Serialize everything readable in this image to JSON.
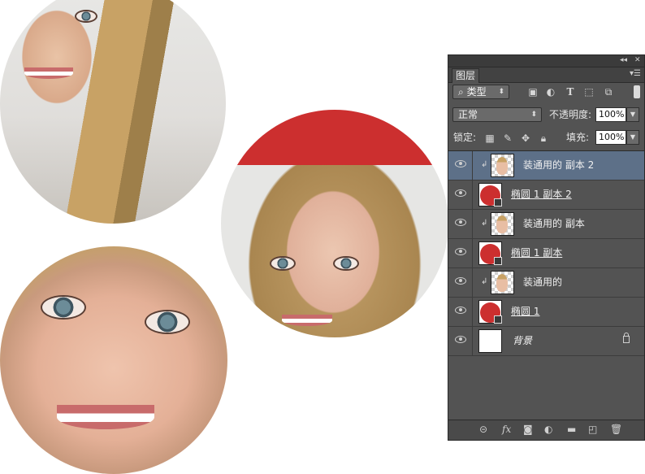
{
  "panel": {
    "collapse_glyph": "◂◂",
    "close_glyph": "✕",
    "tab_label": "图层",
    "menu_glyph": "▾☰",
    "filter": {
      "search_glyph": "⌕",
      "label": "类型",
      "arrow": "⬍"
    },
    "filter_icons": [
      "image-filter-icon",
      "adjustment-filter-icon",
      "type-filter-icon",
      "shape-filter-icon",
      "smart-object-filter-icon"
    ],
    "blend": {
      "value": "正常",
      "arrow": "⬍",
      "opacity_label": "不透明度:",
      "opacity_value": "100%"
    },
    "lock": {
      "label": "锁定:",
      "fill_label": "填充:",
      "fill_value": "100%"
    },
    "layers": [
      {
        "name": "装通用的 副本 2",
        "kind": "photo",
        "clipped": true,
        "selected": true,
        "underline": false,
        "italic": false,
        "locked": false
      },
      {
        "name": "椭圆 1 副本 2",
        "kind": "shape",
        "clipped": false,
        "selected": false,
        "underline": true,
        "italic": false,
        "locked": false
      },
      {
        "name": "装通用的 副本",
        "kind": "photo",
        "clipped": true,
        "selected": false,
        "underline": false,
        "italic": false,
        "locked": false
      },
      {
        "name": "椭圆 1 副本",
        "kind": "shape",
        "clipped": false,
        "selected": false,
        "underline": true,
        "italic": false,
        "locked": false
      },
      {
        "name": "装通用的",
        "kind": "photo",
        "clipped": true,
        "selected": false,
        "underline": false,
        "italic": false,
        "locked": false
      },
      {
        "name": "椭圆 1",
        "kind": "shape",
        "clipped": false,
        "selected": false,
        "underline": true,
        "italic": false,
        "locked": false
      },
      {
        "name": "背景",
        "kind": "background",
        "clipped": false,
        "selected": false,
        "underline": false,
        "italic": true,
        "locked": true
      }
    ],
    "bottom_icons": [
      "link-layers-icon",
      "fx-icon",
      "add-mask-icon",
      "adjustment-layer-icon",
      "new-group-icon",
      "new-layer-icon",
      "delete-layer-icon"
    ],
    "fx_label": "fx",
    "colors": {
      "panel_bg": "#535353",
      "selected_row": "#5d7088",
      "shape_red": "#cc2f2f"
    }
  }
}
